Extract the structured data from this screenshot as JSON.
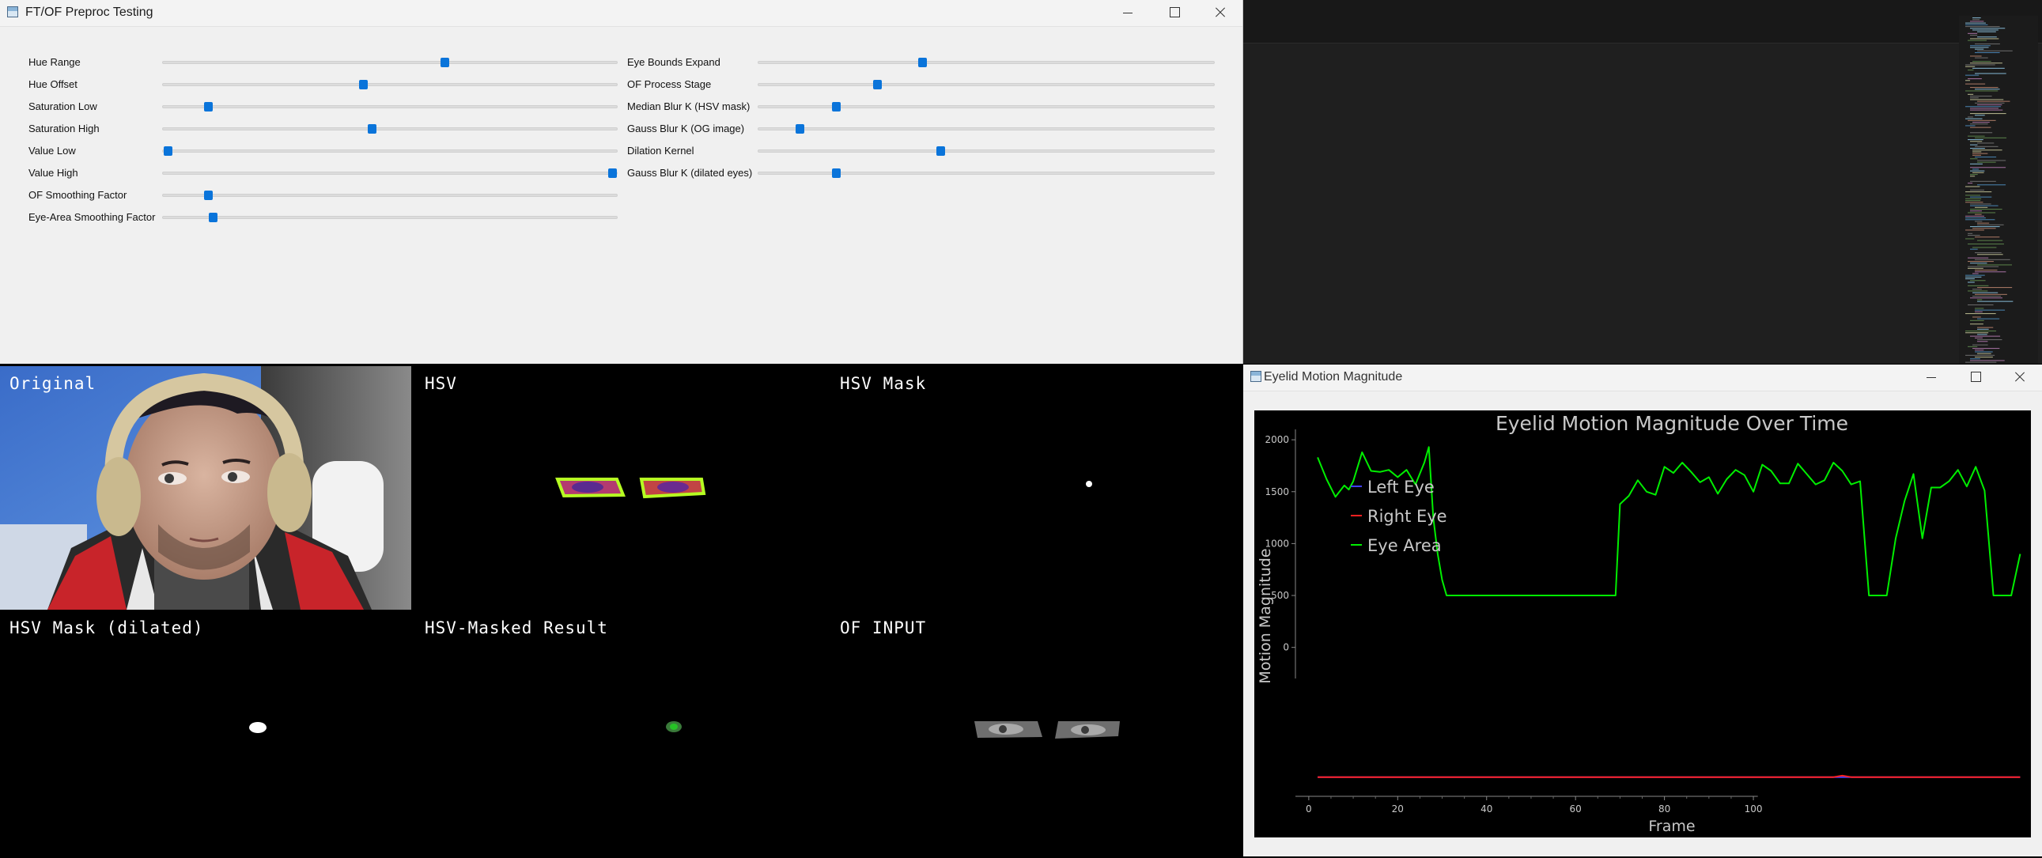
{
  "preproc_window": {
    "title": "FT/OF Preproc Testing",
    "sliders_left": [
      {
        "label": "Hue Range",
        "value": 0.62
      },
      {
        "label": "Hue Offset",
        "value": 0.44
      },
      {
        "label": "Saturation Low",
        "value": 0.1
      },
      {
        "label": "Saturation High",
        "value": 0.46
      },
      {
        "label": "Value Low",
        "value": 0.01
      },
      {
        "label": "Value High",
        "value": 0.99
      },
      {
        "label": "OF Smoothing Factor",
        "value": 0.1
      },
      {
        "label": "Eye-Area Smoothing Factor",
        "value": 0.11
      }
    ],
    "sliders_right": [
      {
        "label": "Eye Bounds Expand",
        "value": 0.36
      },
      {
        "label": "OF Process Stage",
        "value": 0.26
      },
      {
        "label": "Median Blur K (HSV mask)",
        "value": 0.17
      },
      {
        "label": "Gauss Blur K (OG image)",
        "value": 0.09
      },
      {
        "label": "Dilation Kernel",
        "value": 0.4
      },
      {
        "label": "Gauss Blur K (dilated eyes)",
        "value": 0.17
      }
    ]
  },
  "image_panes": {
    "original": "Original",
    "hsv": "HSV",
    "hsv_mask": "HSV Mask",
    "hsv_mask_dilated": "HSV Mask (dilated)",
    "hsv_masked_result": "HSV-Masked Result",
    "of_input": "OF INPUT"
  },
  "plot_window": {
    "title": "Eyelid Motion Magnitude"
  },
  "chart_data": {
    "type": "line",
    "title": "Eyelid Motion Magnitude Over Time",
    "xlabel": "Frame",
    "ylabel": "Motion Magnitude",
    "xlim": [
      -3,
      161
    ],
    "ylim": [
      -1450,
      2100
    ],
    "x_ticks": [
      0,
      20,
      40,
      60,
      80,
      100
    ],
    "y_ticks": [
      0,
      500,
      1000,
      1500,
      2000
    ],
    "legend": "top-left",
    "grid": false,
    "series": [
      {
        "name": "Left Eye",
        "color": "#4040ff",
        "x": [
          2,
          160
        ],
        "y": [
          -1250,
          -1250
        ]
      },
      {
        "name": "Right Eye",
        "color": "#ff2020",
        "x": [
          2,
          20,
          40,
          60,
          80,
          100,
          118,
          120,
          122,
          160
        ],
        "y": [
          -1250,
          -1250,
          -1250,
          -1250,
          -1250,
          -1250,
          -1250,
          -1235,
          -1250,
          -1250
        ]
      },
      {
        "name": "Eye Area",
        "color": "#00ee00",
        "x": [
          2,
          4,
          6,
          8,
          9,
          10,
          12,
          14,
          16,
          18,
          20,
          22,
          24,
          26,
          27,
          28,
          29,
          30,
          31,
          40,
          50,
          60,
          69,
          70,
          72,
          74,
          76,
          78,
          80,
          82,
          84,
          86,
          88,
          90,
          92,
          94,
          96,
          98,
          100,
          102,
          104,
          106,
          108,
          110,
          112,
          114,
          116,
          118,
          120,
          122,
          124,
          126,
          128,
          130,
          132,
          134,
          136,
          138,
          140,
          142,
          144,
          146,
          148,
          150,
          152,
          154,
          156,
          158,
          160
        ],
        "y": [
          1830,
          1620,
          1450,
          1560,
          1520,
          1600,
          1880,
          1700,
          1690,
          1710,
          1640,
          1710,
          1570,
          1780,
          1930,
          1250,
          900,
          650,
          500,
          500,
          500,
          500,
          500,
          1380,
          1460,
          1610,
          1500,
          1470,
          1740,
          1680,
          1780,
          1690,
          1590,
          1640,
          1480,
          1620,
          1710,
          1660,
          1500,
          1760,
          1700,
          1580,
          1580,
          1770,
          1670,
          1570,
          1610,
          1780,
          1700,
          1570,
          1600,
          500,
          500,
          500,
          1050,
          1410,
          1670,
          1050,
          1540,
          1540,
          1600,
          1710,
          1550,
          1740,
          1510,
          500,
          500,
          500,
          900
        ]
      }
    ]
  }
}
